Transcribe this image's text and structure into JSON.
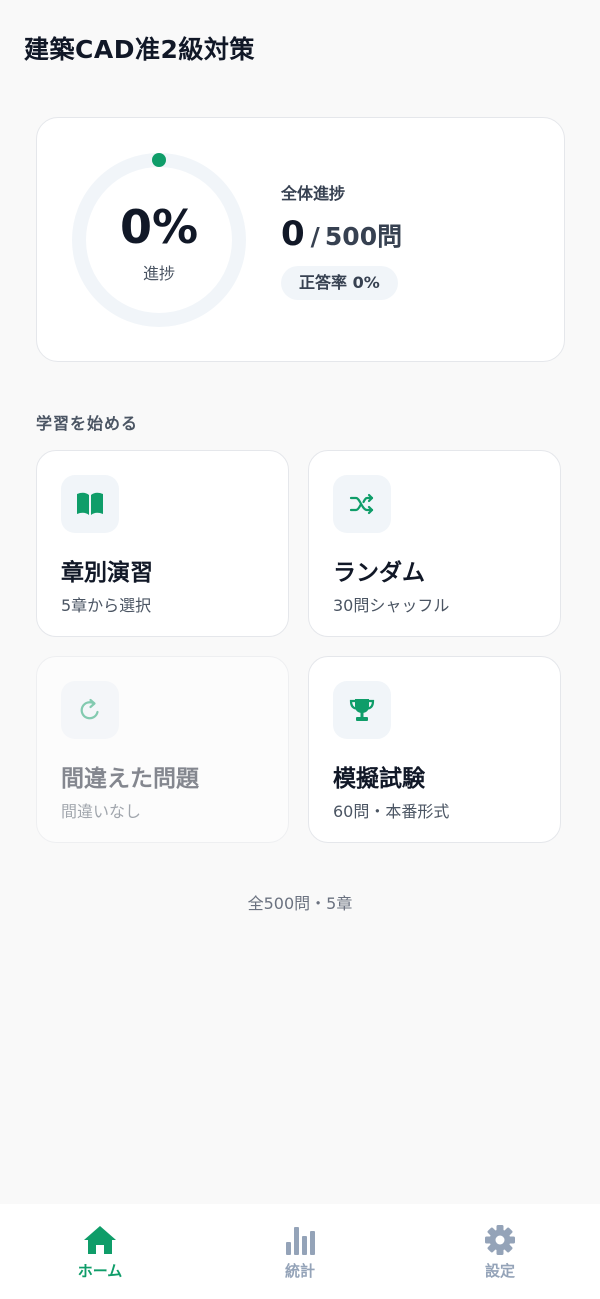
{
  "header": {
    "title": "建築CAD准2級対策"
  },
  "progress": {
    "percent_text": "0%",
    "percent_value": 0,
    "ring_label": "進捗",
    "overall_label": "全体進捗",
    "done": "0",
    "separator": "/",
    "total": "500",
    "unit": "問",
    "accuracy": "正答率 0%"
  },
  "start_section": {
    "heading": "学習を始める",
    "cards": [
      {
        "title": "章別演習",
        "subtitle": "5章から選択",
        "icon": "open-book-icon",
        "enabled": true
      },
      {
        "title": "ランダム",
        "subtitle": "30問シャッフル",
        "icon": "shuffle-icon",
        "enabled": true
      },
      {
        "title": "間違えた問題",
        "subtitle": "間違いなし",
        "icon": "refresh-icon",
        "enabled": false
      },
      {
        "title": "模擬試験",
        "subtitle": "60問・本番形式",
        "icon": "trophy-icon",
        "enabled": true
      }
    ]
  },
  "footer_note": "全500問・5章",
  "bottom_nav": {
    "items": [
      {
        "label": "ホーム",
        "icon": "home-icon",
        "active": true
      },
      {
        "label": "統計",
        "icon": "bar-chart-icon",
        "active": false
      },
      {
        "label": "設定",
        "icon": "gear-icon",
        "active": false
      }
    ]
  },
  "colors": {
    "accent": "#0f9d69",
    "text_primary": "#111827",
    "text_secondary": "#4b5563",
    "nav_inactive": "#94a3b8",
    "background": "#f9f9f9"
  }
}
